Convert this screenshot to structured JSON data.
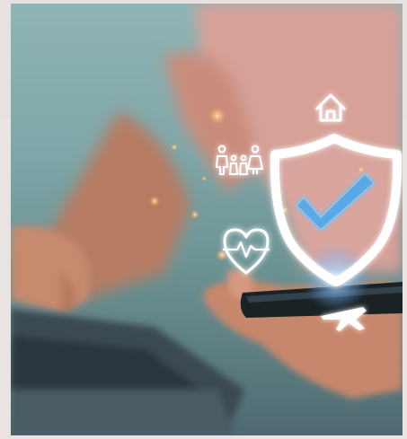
{
  "image": {
    "subject": "hand-holding-smartphone-with-insurance-icons",
    "icons": [
      "house-icon",
      "family-icon",
      "shield-check-icon",
      "heart-pulse-icon",
      "airplane-icon"
    ],
    "colors": {
      "background_teal": "#7fa6a8",
      "shirt_pink": "#d9a098",
      "skin": "#c98f72",
      "laptop": "#3c4b52",
      "phone": "#1c2428",
      "icon_white": "#ffffff",
      "check_blue": "#5aa9e6"
    }
  }
}
